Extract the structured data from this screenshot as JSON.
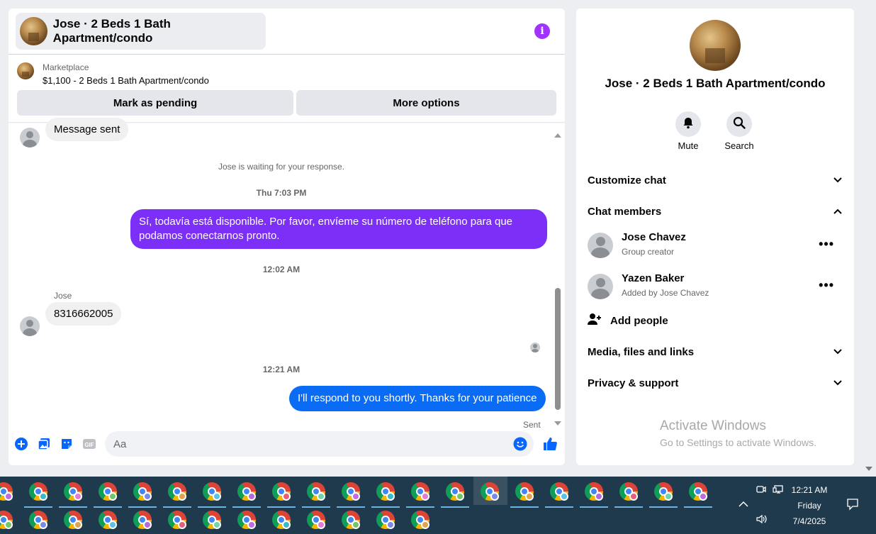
{
  "chat": {
    "title": "Jose · 2 Beds 1 Bath Apartment/condo",
    "marketplace_label": "Marketplace",
    "listing": "$1,100 - 2 Beds 1 Bath Apartment/condo",
    "mark_pending_label": "Mark as pending",
    "more_options_label": "More options",
    "info_icon": "i"
  },
  "messages": {
    "msg1": "Message sent",
    "waiting": "Jose is waiting for your response.",
    "time1": "Thu 7:03 PM",
    "out1": "Sí, todavía está disponible. Por favor, envíeme su número de teléfono para que podamos conectarnos pronto.",
    "time2": "12:02 AM",
    "sender": "Jose",
    "in2": "8316662005",
    "time3": "12:21 AM",
    "out2": "I'll respond to you shortly. Thanks for your patience",
    "sent_status": "Sent"
  },
  "composer": {
    "placeholder": "Aa"
  },
  "info": {
    "title": "Jose · 2 Beds 1 Bath Apartment/condo",
    "mute_label": "Mute",
    "search_label": "Search",
    "customize_chat": "Customize chat",
    "chat_members": "Chat members",
    "members": [
      {
        "name": "Jose Chavez",
        "sub": "Group creator"
      },
      {
        "name": "Yazen Baker",
        "sub": "Added by Jose Chavez"
      }
    ],
    "add_people": "Add people",
    "media_files": "Media, files and links",
    "privacy_support": "Privacy & support",
    "more_glyph": "•••"
  },
  "watermark": {
    "line1": "Activate Windows",
    "line2": "Go to Settings to activate Windows."
  },
  "taskbar": {
    "time": "12:21 AM",
    "day": "Friday",
    "date": "7/4/2025"
  },
  "colors": {
    "purple_bubble": "#7b2ff7",
    "blue_bubble": "#0a6cf5",
    "messenger_blue": "#0866ff",
    "info_purple": "#a033ff",
    "taskbar": "#1f3a4d"
  }
}
